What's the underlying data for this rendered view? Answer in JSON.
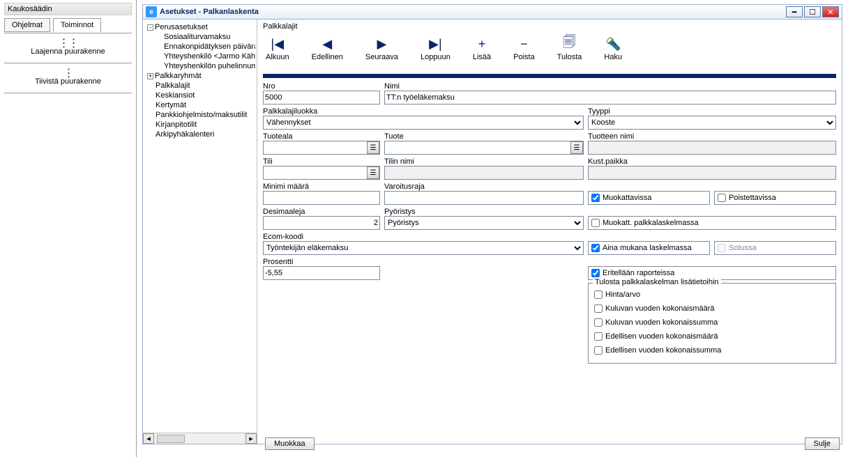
{
  "leftPanel": {
    "title": "Kaukosäädin",
    "tabs": {
      "programs": "Ohjelmat",
      "actions": "Toiminnot"
    },
    "expand": "Laajenna puurakenne",
    "collapse": "Tiivistä puurakenne"
  },
  "window": {
    "caption": "Asetukset - Palkanlaskenta",
    "section": "Palkkalajit",
    "toolbar": {
      "first": "Alkuun",
      "prev": "Edellinen",
      "next": "Seuraava",
      "last": "Loppuun",
      "add": "Lisää",
      "del": "Poista",
      "print": "Tulosta",
      "search": "Haku"
    },
    "muokkaa": "Muokkaa",
    "close": "Sulje"
  },
  "tree": {
    "root": "Perusasetukset",
    "sotu": "Sosiaaliturvamaksu",
    "ennak": "Ennakonpidätyksen päivära",
    "yht1": "Yhteyshenkilö <Jarmo Kähk",
    "yht2": "Yhteyshenkilön puhelinnum",
    "palkkaryhmat": "Palkkaryhmät",
    "palkkalajit": "Palkkalajit",
    "keskiansiot": "Keskiansiot",
    "kertymat": "Kertymät",
    "pankki": "Pankkiohjelmisto/maksutilit",
    "kirjanpito": "Kirjanpitotilit",
    "arki": "Arkipyhäkalenteri"
  },
  "labels": {
    "nro": "Nro",
    "nimi": "Nimi",
    "luokka": "Palkkalajiluokka",
    "tyyppi": "Tyyppi",
    "tuoteala": "Tuoteala",
    "tuote": "Tuote",
    "tuotteenNimi": "Tuotteen nimi",
    "tili": "Tili",
    "tilinNimi": "Tilin nimi",
    "kust": "Kust.paikka",
    "minMaara": "Minimi määrä",
    "varoitus": "Varoitusraja",
    "desim": "Desimaaleja",
    "pyor": "Pyöristys",
    "ecom": "Ecom-koodi",
    "pros": "Prosentti",
    "muokatt": "Muokattavissa",
    "poistett": "Poistettavissa",
    "muokPalk": "Muokatt. palkkalaskelmassa",
    "aina": "Aina mukana laskelmassa",
    "sotussa": "Sotussa",
    "erit": "Eritellään raporteissa",
    "group": "Tulosta palkkalaskelman lisätietoihin",
    "hinta": "Hinta/arvo",
    "kulM": "Kuluvan vuoden kokonaismäärä",
    "kulS": "Kuluvan vuoden kokonaissumma",
    "edM": "Edellisen vuoden kokonaismäärä",
    "edS": "Edellisen vuoden kokonaissumma"
  },
  "values": {
    "nro": "5000",
    "nimi": "TT:n työeläkemaksu",
    "luokka": "Vähennykset",
    "tyyppi": "Kooste",
    "tuoteala": "",
    "tuote": "",
    "tuotteenNimi": "",
    "tili": "",
    "tilinNimi": "",
    "kust": "",
    "minMaara": "",
    "varoitus": "",
    "desim": "2",
    "pyor": "Pyöristys",
    "ecom": "Työntekijän eläkemaksu",
    "pros": "-5,55",
    "muokatt": true,
    "poistett": false,
    "muokPalk": false,
    "aina": true,
    "sotussa": false,
    "erit": true,
    "hinta": false,
    "kulM": false,
    "kulS": false,
    "edM": false,
    "edS": false
  }
}
